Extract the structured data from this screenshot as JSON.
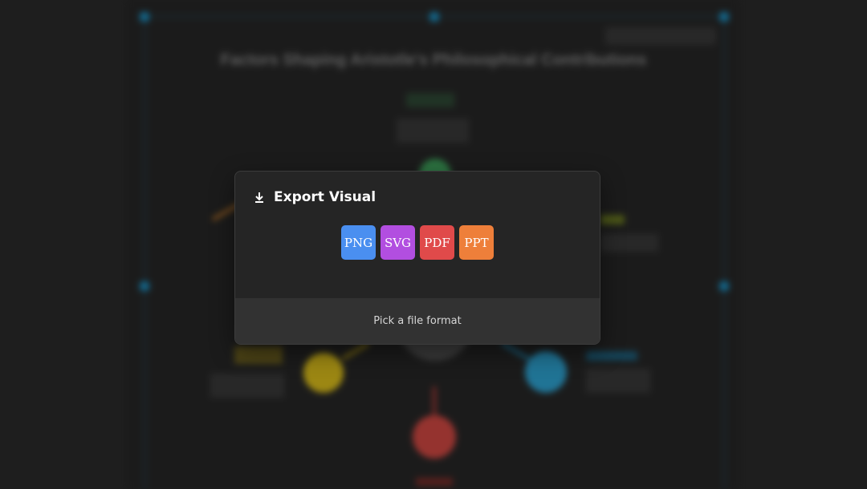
{
  "background": {
    "title": "Factors Shaping Aristotle's Philosophical Contributions",
    "nodes": [
      {
        "id": "top",
        "color": "#3fa35c"
      },
      {
        "id": "upper-left",
        "color": "#c47a2a"
      },
      {
        "id": "right",
        "color": "#8aa02a"
      },
      {
        "id": "lower-left",
        "color": "#e0c21c"
      },
      {
        "id": "lower-right",
        "color": "#2fa6d6"
      },
      {
        "id": "bottom",
        "color": "#d64a44"
      }
    ]
  },
  "modal": {
    "title": "Export Visual",
    "icon": "download-icon",
    "formats": [
      {
        "label": "PNG",
        "color": "#4a8ff0"
      },
      {
        "label": "SVG",
        "color": "#b24ee0"
      },
      {
        "label": "PDF",
        "color": "#e04a4a"
      },
      {
        "label": "PPT",
        "color": "#ee7f3a"
      }
    ],
    "footer": "Pick a file format"
  }
}
